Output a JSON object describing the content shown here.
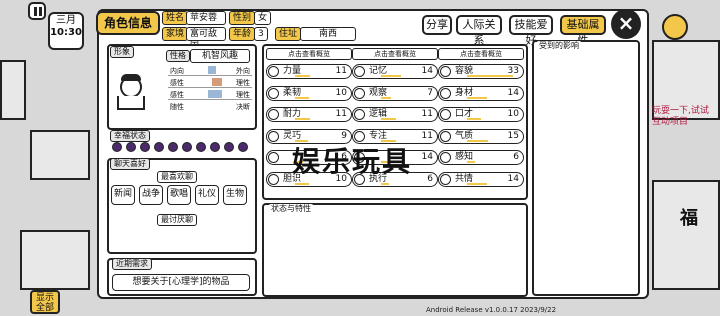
{
  "hud": {
    "date_month": "三月",
    "date_time": "10:30",
    "show_all": "显示全部",
    "right_text_1": "玩耍一下,试试",
    "right_text_2": "互动项目",
    "right_badge": "福"
  },
  "header": {
    "title": "角色信息",
    "surname_label": "姓名",
    "surname_value": "苹安蓉",
    "gender_label": "性别",
    "gender_value": "女",
    "family_label": "家境",
    "family_value": "富可敌国",
    "age_label": "年龄",
    "age_value": "3",
    "address_label": "住址",
    "address_value": "南西",
    "share_btn": "分享",
    "relations_btn": "人际关系",
    "skills_btn": "技能爱好",
    "attributes_btn": "基础属性"
  },
  "left": {
    "appearance_title": "形象",
    "personality_title": "性格",
    "personality_value": "机智风趣",
    "traits": [
      {
        "left": "内向",
        "right": "外向"
      },
      {
        "left": "感性",
        "right": "理性"
      },
      {
        "left": "感性",
        "right": "理性"
      },
      {
        "left": "随性",
        "right": "决断"
      }
    ],
    "happiness_title": "幸福状态",
    "hearts_count": 10,
    "chat_title": "聊天喜好",
    "likes_title": "最喜欢聊",
    "likes": [
      "新闻",
      "战争",
      "歌唱",
      "礼仪",
      "生物"
    ],
    "dislikes_title": "最讨厌聊",
    "recent_title": "近期需求",
    "recent_text": "想要关于[心理学]的物品"
  },
  "stats": {
    "column_header": "点击查看概览",
    "columns": [
      [
        {
          "name": "力量",
          "value": "11"
        },
        {
          "name": "柔韧",
          "value": "10"
        },
        {
          "name": "耐力",
          "value": "11"
        },
        {
          "name": "灵巧",
          "value": "9"
        },
        {
          "name": "",
          "value": "6"
        },
        {
          "name": "胆识",
          "value": "10"
        }
      ],
      [
        {
          "name": "记忆",
          "value": "14"
        },
        {
          "name": "观察",
          "value": "7"
        },
        {
          "name": "逻辑",
          "value": "11"
        },
        {
          "name": "专注",
          "value": "11"
        },
        {
          "name": "",
          "value": "14"
        },
        {
          "name": "执行",
          "value": "6"
        }
      ],
      [
        {
          "name": "容貌",
          "value": "33"
        },
        {
          "name": "身材",
          "value": "14"
        },
        {
          "name": "口才",
          "value": "10"
        },
        {
          "name": "气质",
          "value": "15"
        },
        {
          "name": "感知",
          "value": "6"
        },
        {
          "name": "共情",
          "value": "14"
        }
      ]
    ],
    "status_title": "状态与特性",
    "influence_title": "受到的影响"
  },
  "watermark": "娱乐玩具",
  "footer": "Android Release v1.0.0.17  2023/9/22"
}
